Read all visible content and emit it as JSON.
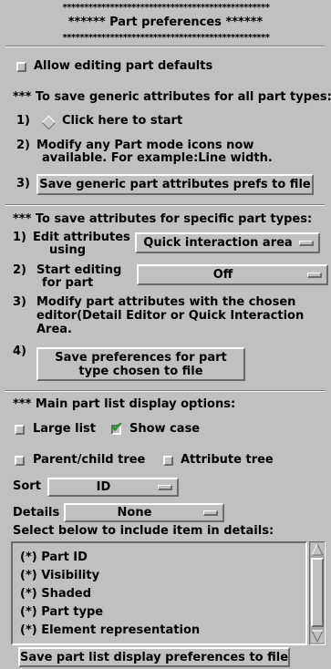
{
  "header": {
    "stars_top": "************************************************",
    "title": "****** Part preferences ******",
    "stars_bottom": "************************************************"
  },
  "allow_editing": {
    "label": "Allow editing part defaults",
    "checked": false
  },
  "generic": {
    "heading": "*** To save generic attributes for all part types:",
    "step1_num": "1)",
    "step1_label": "Click here to start",
    "step2_num": "2)",
    "step2_line1": "Modify any Part mode icons now",
    "step2_line2": "available. For example:Line width.",
    "step3_num": "3)",
    "step3_button": "Save generic part attributes prefs to file"
  },
  "specific": {
    "heading": "*** To save attributes for specific part types:",
    "step1_num": "1)",
    "step1_line1": "Edit attributes",
    "step1_line2": "using",
    "editor_select": "Quick interaction area",
    "step2_num": "2)",
    "step2_line1": "Start editing",
    "step2_line2": "for part",
    "part_select": "Off",
    "step3_num": "3)",
    "step3_line1": "Modify part attributes with the chosen",
    "step3_line2": "editor(Detail Editor or Quick Interaction",
    "step3_line3": "Area.",
    "step4_num": "4)",
    "step4_button_line1": "Save preferences for part",
    "step4_button_line2": "type chosen to file"
  },
  "display": {
    "heading": "*** Main part list display options:",
    "large_list": {
      "label": "Large list",
      "checked": false
    },
    "show_case": {
      "label": "Show case",
      "checked": true
    },
    "parent_child": {
      "label": "Parent/child tree",
      "checked": false
    },
    "attribute_tree": {
      "label": "Attribute tree",
      "checked": false
    },
    "sort_label": "Sort",
    "sort_value": "ID",
    "details_label": "Details",
    "details_value": "None",
    "include_label": "Select below to include item in details:",
    "items": [
      "(*) Part ID",
      "(*) Visibility",
      "(*) Shaded",
      "(*) Part type",
      "(*) Element representation"
    ],
    "save_button": "Save part list display preferences to file"
  },
  "icons": {
    "check_mark": "✔",
    "start_icon": "diamond-icon"
  }
}
